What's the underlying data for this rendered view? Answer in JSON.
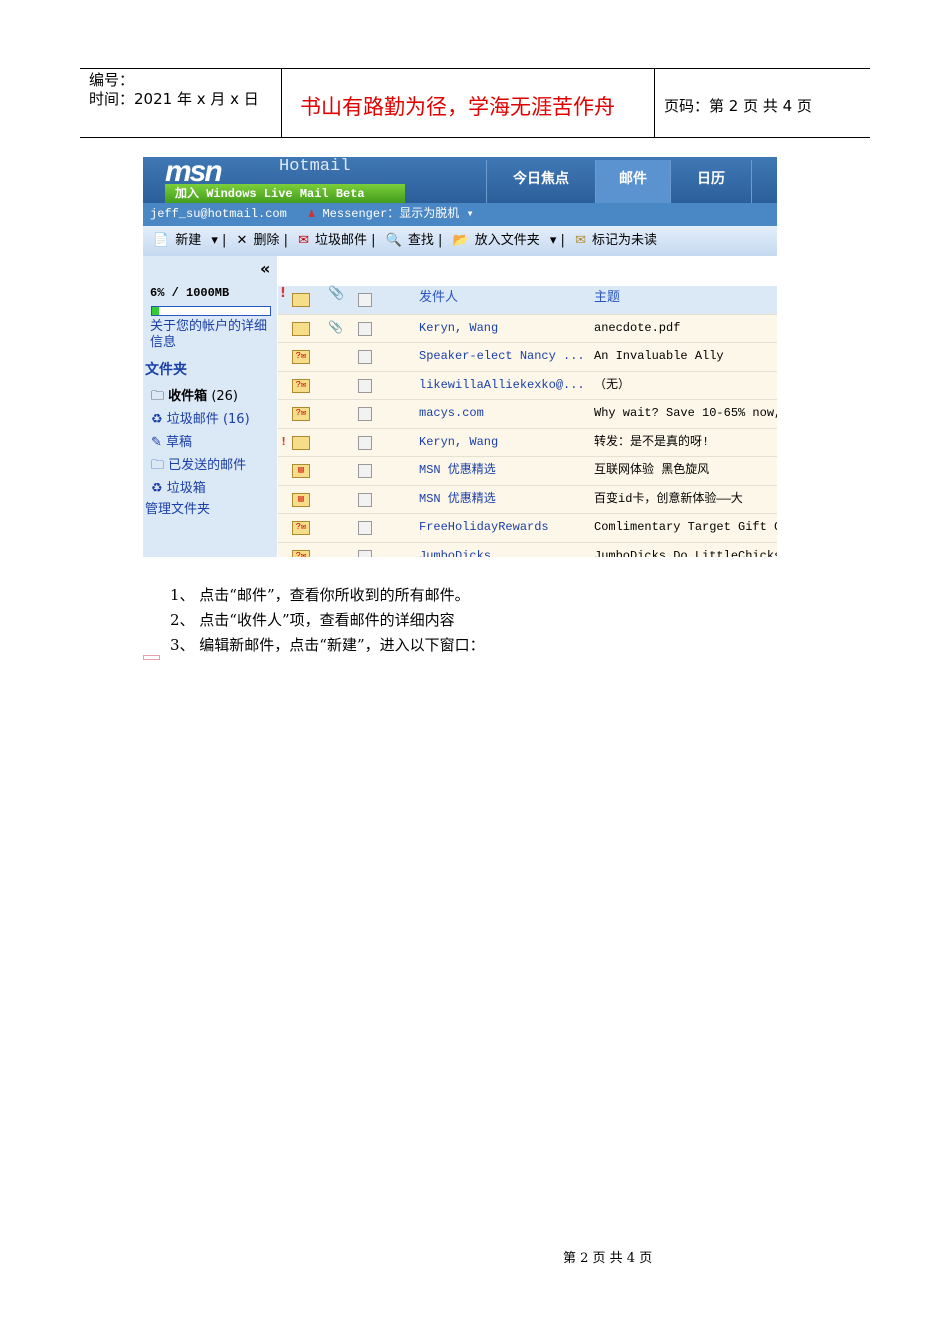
{
  "header": {
    "number_label": "编号：",
    "date_label": "时间：2021 年 x 月 x 日",
    "motto": "书山有路勤为径，学海无涯苦作舟",
    "page_label": "页码：第 2 页  共 4 页"
  },
  "screenshot": {
    "logo": "msn",
    "product": "Hotmail",
    "beta_banner": "加入 Windows Live Mail Beta",
    "tabs": [
      "今日焦点",
      "邮件",
      "日历"
    ],
    "account": "jeff_su@hotmail.com",
    "messenger": "Messenger：显示为脱机",
    "toolbar": [
      "新建",
      "删除",
      "垃圾邮件",
      "查找",
      "放入文件夹",
      "标记为未读"
    ],
    "collapse": "«",
    "quota": "6% / 1000MB",
    "quota_fraction": 0.06,
    "account_info": "关于您的帐户的详细信息",
    "folders_title": "文件夹",
    "folders": [
      {
        "name": "收件箱",
        "count": "(26)"
      },
      {
        "name": "垃圾邮件",
        "count": "(16)"
      },
      {
        "name": "草稿",
        "count": ""
      },
      {
        "name": "已发送的邮件",
        "count": ""
      },
      {
        "name": "垃圾箱",
        "count": ""
      }
    ],
    "manage": "管理文件夹",
    "columns": {
      "from": "发件人",
      "subject": "主题"
    },
    "rows": [
      {
        "from": "Keryn, Wang",
        "subject": "anecdote.pdf",
        "icon": "envelope",
        "important": false,
        "attach": true
      },
      {
        "from": "Speaker-elect Nancy ...",
        "subject": "An Invaluable Ally",
        "icon": "unknown-mail",
        "important": false,
        "attach": false
      },
      {
        "from": "likewillaAlliekexko@...",
        "subject": "（无）",
        "icon": "unknown-mail",
        "important": false,
        "attach": false
      },
      {
        "from": "macys.com",
        "subject": "Why wait? Save 10-65% now,",
        "icon": "unknown-mail",
        "important": false,
        "attach": false
      },
      {
        "from": "Keryn, Wang",
        "subject": "转发：是不是真的呀!",
        "icon": "envelope",
        "important": true,
        "attach": false
      },
      {
        "from": "MSN 优惠精选",
        "subject": "互联网体验 黑色旋风",
        "icon": "newsletter",
        "important": false,
        "attach": false
      },
      {
        "from": "MSN 优惠精选",
        "subject": "百变id卡，创意新体验——大",
        "icon": "newsletter",
        "important": false,
        "attach": false
      },
      {
        "from": "FreeHolidayRewards",
        "subject": "Comlimentary Target Gift C",
        "icon": "unknown-mail",
        "important": false,
        "attach": false
      },
      {
        "from": "JumboDicks",
        "subject": "JumboDicks Do LittleChicks",
        "icon": "unknown-mail",
        "important": false,
        "attach": false
      }
    ]
  },
  "steps": [
    "1、 点击“邮件”，查看你所收到的所有邮件。",
    "2、 点击“收件人”项，查看邮件的详细内容",
    "3、 编辑新邮件，点击“新建”，进入以下窗口："
  ],
  "footer": "第 2 页 共 4 页"
}
